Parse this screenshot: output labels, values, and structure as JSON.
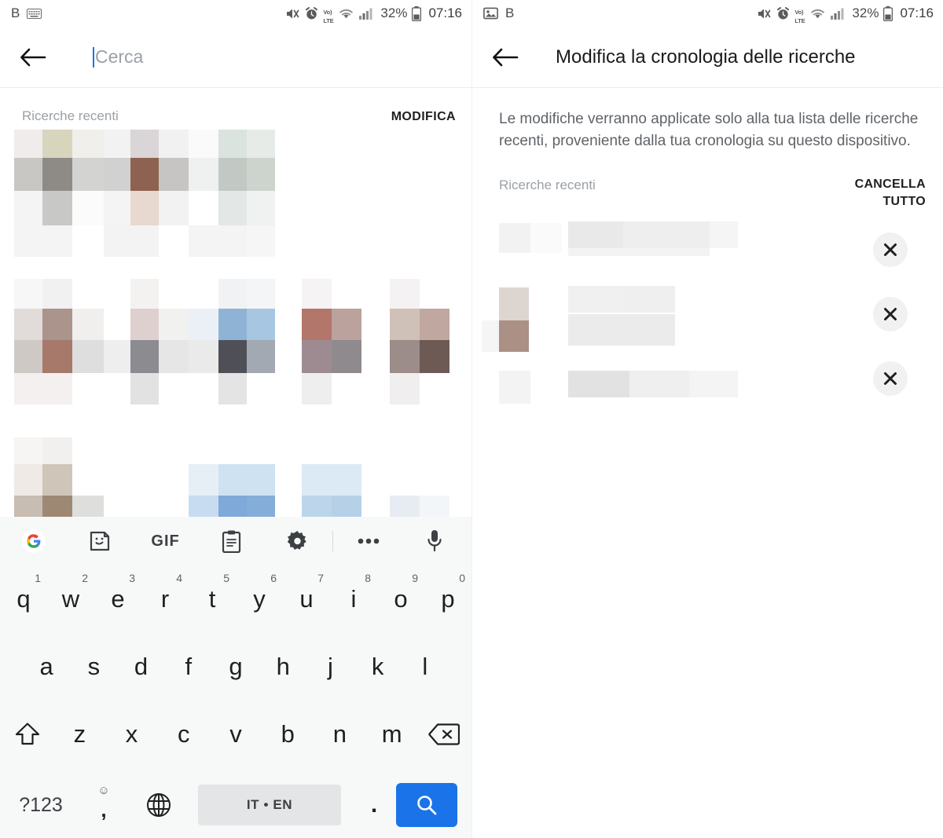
{
  "statusbar": {
    "left_letter": "B",
    "left_icon_left": "keyboard-icon",
    "right_icon_left": "image-icon",
    "icons": [
      "mute-icon",
      "alarm-icon",
      "volte-icon",
      "wifi-icon",
      "signal-icon"
    ],
    "volte_top": "Vo)",
    "volte_bottom": "LTE",
    "battery_percent": "32%",
    "time": "07:16"
  },
  "left_panel": {
    "appbar": {
      "back_icon": "back-arrow-icon",
      "search_placeholder": "Cerca",
      "search_value": ""
    },
    "recent": {
      "label": "Ricerche recenti",
      "action": "MODIFICA"
    }
  },
  "right_panel": {
    "appbar": {
      "back_icon": "back-arrow-icon",
      "title": "Modifica la cronologia delle ricerche"
    },
    "description": "Le modifiche verranno applicate solo alla tua lista delle ricerche recenti, proveniente dalla tua cronologia su questo dispositivo.",
    "recent": {
      "label": "Ricerche recenti",
      "action": "CANCELLA TUTTO"
    },
    "items": [
      {
        "remove_icon": "close-icon"
      },
      {
        "remove_icon": "close-icon"
      },
      {
        "remove_icon": "close-icon"
      }
    ]
  },
  "keyboard": {
    "toolbar": [
      {
        "name": "google-logo-icon",
        "label": ""
      },
      {
        "name": "sticker-icon",
        "label": ""
      },
      {
        "name": "gif-icon",
        "label": "GIF"
      },
      {
        "name": "clipboard-icon",
        "label": ""
      },
      {
        "name": "gear-icon",
        "label": ""
      },
      {
        "name": "more-icon",
        "label": ""
      },
      {
        "name": "microphone-icon",
        "label": ""
      }
    ],
    "row1": [
      {
        "key": "q",
        "hint": "1"
      },
      {
        "key": "w",
        "hint": "2"
      },
      {
        "key": "e",
        "hint": "3"
      },
      {
        "key": "r",
        "hint": "4"
      },
      {
        "key": "t",
        "hint": "5"
      },
      {
        "key": "y",
        "hint": "6"
      },
      {
        "key": "u",
        "hint": "7"
      },
      {
        "key": "i",
        "hint": "8"
      },
      {
        "key": "o",
        "hint": "9"
      },
      {
        "key": "p",
        "hint": "0"
      }
    ],
    "row2": [
      "a",
      "s",
      "d",
      "f",
      "g",
      "h",
      "j",
      "k",
      "l"
    ],
    "row3": [
      "z",
      "x",
      "c",
      "v",
      "b",
      "n",
      "m"
    ],
    "shift_icon": "shift-icon",
    "backspace_icon": "backspace-icon",
    "numeric_key": "?123",
    "comma_key": ",",
    "emoji_hint": "☺",
    "globe_icon": "globe-icon",
    "space_label": "IT • EN",
    "period_key": ".",
    "search_icon": "search-icon"
  },
  "colors": {
    "accent_blue": "#1a73e8",
    "keyboard_bg": "#f7f8f8",
    "space_key_bg": "#e4e5e6",
    "muted_text": "#9aa0a6"
  }
}
